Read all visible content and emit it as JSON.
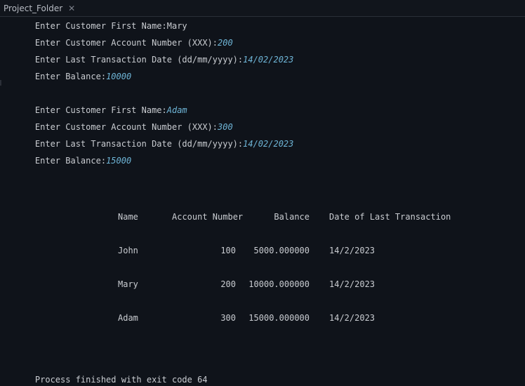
{
  "tab": {
    "title": "Project_Folder"
  },
  "console": {
    "partial_top": "Enter Customer First Name:Mary",
    "inputs": [
      {
        "prompt": "Enter Customer Account Number (XXX):",
        "value": "200"
      },
      {
        "prompt": "Enter Last Transaction Date (dd/mm/yyyy):",
        "value": "14/02/2023"
      },
      {
        "prompt": "Enter Balance:",
        "value": "10000"
      },
      {
        "prompt": "Enter Customer First Name:",
        "value": "Adam"
      },
      {
        "prompt": "Enter Customer Account Number (XXX):",
        "value": "300"
      },
      {
        "prompt": "Enter Last Transaction Date (dd/mm/yyyy):",
        "value": "14/02/2023"
      },
      {
        "prompt": "Enter Balance:",
        "value": "15000"
      }
    ],
    "table": {
      "headers": [
        "Name",
        "Account Number",
        "Balance",
        "Date of Last Transaction"
      ],
      "rows": [
        [
          "John",
          "100",
          "5000.000000",
          "14/2/2023"
        ],
        [
          "Mary",
          "200",
          "10000.000000",
          "14/2/2023"
        ],
        [
          "Adam",
          "300",
          "15000.000000",
          "14/2/2023"
        ]
      ]
    },
    "exit_message": "Process finished with exit code 64"
  },
  "colors": {
    "background": "#0f131a",
    "text": "#c9ccd1",
    "input": "#6fb6d8"
  }
}
